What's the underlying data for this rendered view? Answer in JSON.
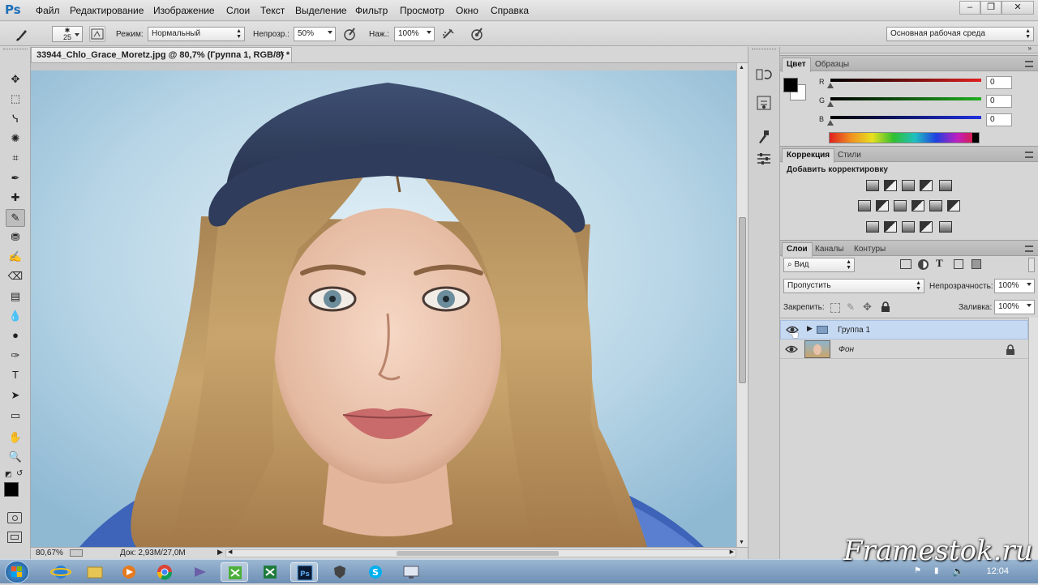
{
  "app": {
    "logo": "Ps",
    "menu": [
      "Файл",
      "Редактирование",
      "Изображение",
      "Слои",
      "Текст",
      "Выделение",
      "Фильтр",
      "Просмотр",
      "Окно",
      "Справка"
    ],
    "window_controls": [
      "–",
      "❐",
      "✕"
    ]
  },
  "options_bar": {
    "brush_size": "25",
    "mode_label": "Режим:",
    "mode_value": "Нормальный",
    "opacity_label": "Непрозр.:",
    "opacity_value": "50%",
    "pressure_label": "Наж.:",
    "pressure_value": "100%",
    "workspace": "Основная рабочая среда"
  },
  "document": {
    "tab_title": "33944_Chlo_Grace_Moretz.jpg @ 80,7% (Группа 1, RGB/8) *",
    "close": "×",
    "zoom": "80,67%",
    "doc_info": "Док: 2,93M/27,0M"
  },
  "tools": [
    "move-tool",
    "marquee-tool",
    "lasso-tool",
    "quick-select-tool",
    "crop-tool",
    "eyedropper-tool",
    "healing-brush-tool",
    "brush-tool",
    "clone-stamp-tool",
    "history-brush-tool",
    "eraser-tool",
    "gradient-tool",
    "blur-tool",
    "dodge-tool",
    "pen-tool",
    "type-tool",
    "path-select-tool",
    "rectangle-tool",
    "hand-tool",
    "zoom-tool"
  ],
  "color_panel": {
    "tabs": [
      "Цвет",
      "Образцы"
    ],
    "channels": [
      {
        "label": "R",
        "value": "0",
        "color": "#e02020"
      },
      {
        "label": "G",
        "value": "0",
        "color": "#20b020"
      },
      {
        "label": "B",
        "value": "0",
        "color": "#2030e0"
      }
    ]
  },
  "adjustments_panel": {
    "tabs": [
      "Коррекция",
      "Стили"
    ],
    "heading": "Добавить корректировку"
  },
  "layers_panel": {
    "tabs": [
      "Слои",
      "Каналы",
      "Контуры"
    ],
    "filter": "Вид",
    "blend_mode": "Пропустить",
    "opacity_label": "Непрозрачность:",
    "opacity_value": "100%",
    "lock_label": "Закрепить:",
    "fill_label": "Заливка:",
    "fill_value": "100%",
    "layers": [
      {
        "name": "Группа 1",
        "type": "group",
        "selected": true
      },
      {
        "name": "Фон",
        "type": "image",
        "locked": true
      }
    ]
  },
  "taskbar": {
    "clock": "12:04"
  },
  "watermark": "Framestok.ru"
}
